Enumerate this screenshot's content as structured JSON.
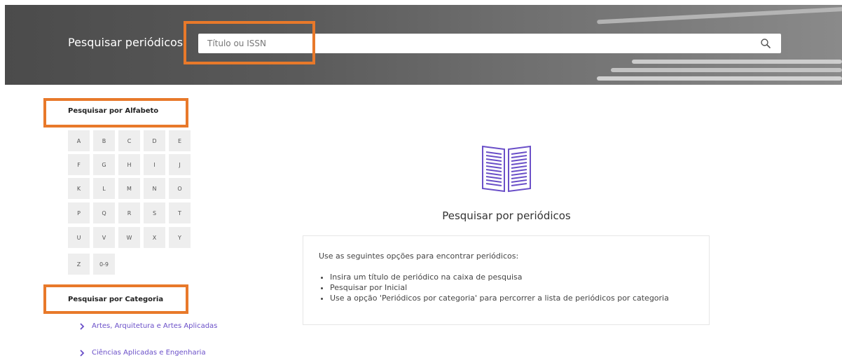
{
  "header": {
    "title": "Pesquisar periódicos",
    "search_placeholder": "Título ou ISSN",
    "search_icon": "search-icon"
  },
  "sidebar": {
    "alphabet_title": "Pesquisar por Alfabeto",
    "letters": [
      "A",
      "B",
      "C",
      "D",
      "E",
      "F",
      "G",
      "H",
      "I",
      "J",
      "K",
      "L",
      "M",
      "N",
      "O",
      "P",
      "Q",
      "R",
      "S",
      "T",
      "U",
      "V",
      "W",
      "X",
      "Y",
      "Z",
      "0-9"
    ],
    "category_title": "Pesquisar por Categoria",
    "categories": [
      {
        "label": "Artes, Arquitetura e Artes Aplicadas",
        "icon": "chevron-right-icon"
      },
      {
        "label": "Ciências Aplicadas e Engenharia",
        "icon": "chevron-right-icon"
      }
    ]
  },
  "main": {
    "icon": "open-book-icon",
    "title": "Pesquisar por periódicos",
    "intro": "Use as seguintes opções para encontrar periódicos:",
    "bullets": [
      "Insira um título de periódico na caixa de pesquisa",
      "Pesquisar por Inicial",
      "Use a opção 'Periódicos por categoria' para percorrer a lista de periódicos por categoria"
    ]
  },
  "colors": {
    "highlight": "#e8792a",
    "accent": "#6a4fc8",
    "banner": "#555555"
  }
}
